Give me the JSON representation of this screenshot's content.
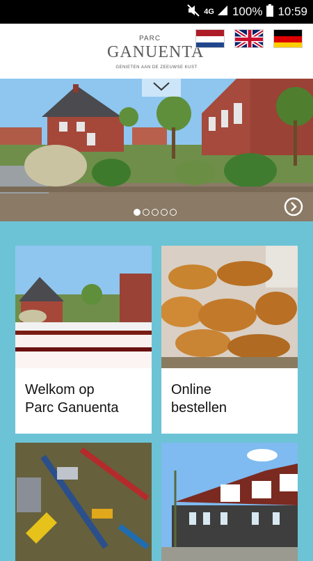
{
  "status_bar": {
    "network": "4G",
    "battery": "100%",
    "time": "10:59"
  },
  "header": {
    "logo": {
      "small": "PARC",
      "name": "GANUENTA",
      "tagline": "GENIETEN AAN DE ZEEUWSE KUST"
    },
    "languages": [
      {
        "code": "nl",
        "icon": "netherlands-flag-icon"
      },
      {
        "code": "en",
        "icon": "uk-flag-icon"
      },
      {
        "code": "de",
        "icon": "germany-flag-icon"
      }
    ]
  },
  "carousel": {
    "slide_count": 5,
    "active_index": 0,
    "toggle_icon": "chevron-down-icon",
    "next_icon": "arrow-right-circle-icon"
  },
  "tiles": [
    {
      "label_line1": "Welkom op",
      "label_line2": "Parc Ganuenta",
      "image": "red-brick-houses"
    },
    {
      "label_line1": "Online",
      "label_line2": "bestellen",
      "image": "croissants"
    },
    {
      "label_line1": "",
      "label_line2": "",
      "image": "tools"
    },
    {
      "label_line1": "",
      "label_line2": "",
      "image": "holiday-houses"
    }
  ],
  "colors": {
    "page_background": "#6cc3d5",
    "status_bar": "#000000",
    "header": "#ffffff"
  }
}
